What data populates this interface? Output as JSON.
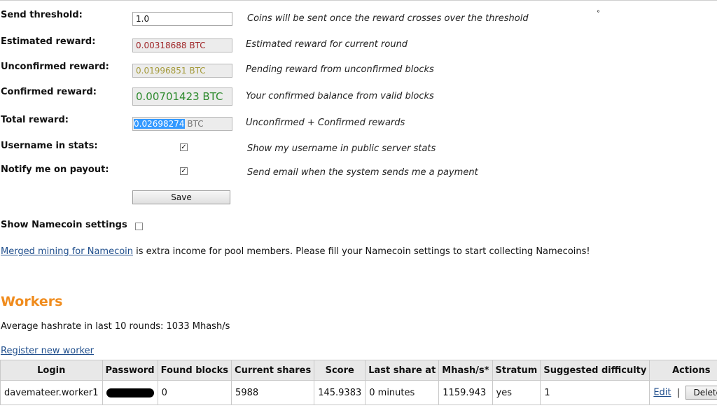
{
  "settings": {
    "send_threshold": {
      "label": "Send threshold:",
      "value": "1.0",
      "desc": "Coins will be sent once the reward crosses over the threshold"
    },
    "estimated_reward": {
      "label": "Estimated reward:",
      "value": "0.00318688 BTC",
      "desc": "Estimated reward for current round",
      "color": "#a0282a"
    },
    "unconfirmed_reward": {
      "label": "Unconfirmed reward:",
      "value": "0.01996851 BTC",
      "desc": "Pending reward from unconfirmed blocks",
      "color": "#a49a3a"
    },
    "confirmed_reward": {
      "label": "Confirmed reward:",
      "value": "0.00701423 BTC",
      "desc": "Your confirmed balance from valid blocks",
      "color": "#2d8a2d"
    },
    "total_reward": {
      "label": "Total reward:",
      "value_selected": "0.02698274",
      "unit": " BTC",
      "desc": "Unconfirmed + Confirmed rewards"
    },
    "username_in_stats": {
      "label": "Username in stats:",
      "checked": true,
      "check_glyph": "✓",
      "desc": "Show my username in public server stats"
    },
    "notify_on_payout": {
      "label": "Notify me on payout:",
      "checked": true,
      "check_glyph": "✓",
      "desc": "Send email when the system sends me a payment"
    },
    "save_label": "Save",
    "namecoin": {
      "label": "Show Namecoin settings",
      "checked": false
    },
    "merged": {
      "link_text": "Merged mining for Namecoin",
      "text": " is extra income for pool members. Please fill your Namecoin settings to start collecting Namecoins!"
    },
    "stray_mark": "°"
  },
  "workers": {
    "title": "Workers",
    "avg_hashrate": "Average hashrate in last 10 rounds: 1033 Mhash/s",
    "register_link": "Register new worker",
    "columns": [
      "Login",
      "Password",
      "Found blocks",
      "Current shares",
      "Score",
      "Last share at",
      "Mhash/s*",
      "Stratum",
      "Suggested difficulty",
      "Actions"
    ],
    "rows": [
      {
        "login": "davemateer.worker1",
        "found_blocks": "0",
        "current_shares": "5988",
        "score": "145.9383",
        "last_share": "0 minutes",
        "mhash": "1159.943",
        "stratum": "yes",
        "difficulty": "1",
        "edit": "Edit",
        "sep": "|",
        "delete": "Delete"
      }
    ]
  },
  "colors": {
    "accent": "#f08c1e",
    "link": "#1f4e8c",
    "selection": "#3399ff"
  }
}
